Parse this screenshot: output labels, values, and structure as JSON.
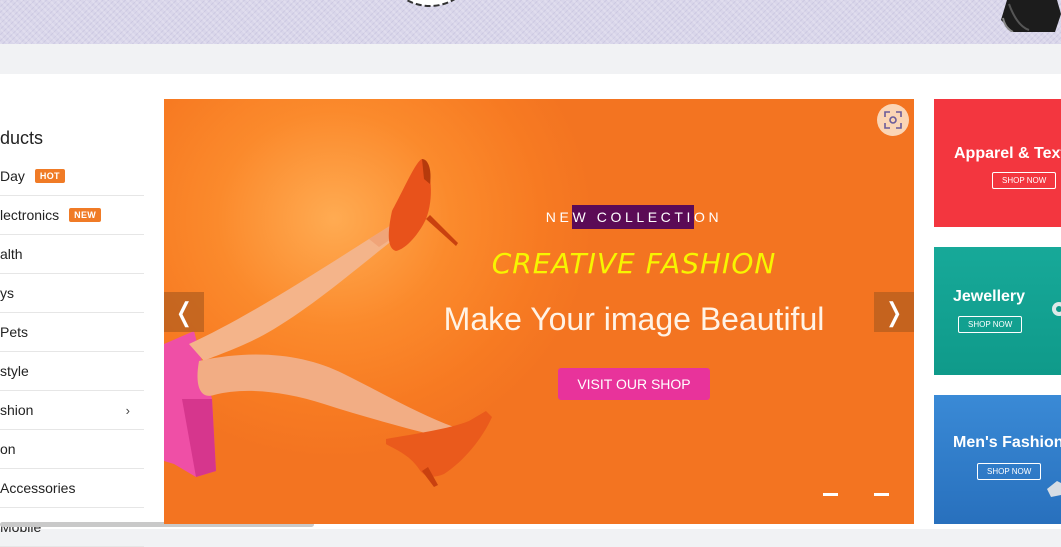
{
  "colors": {
    "hero_bg": "#f77a22",
    "visit_button": "#e8339b",
    "highlight": "#5b0b56",
    "creative_text": "#f7f500",
    "badge": "#f07b26",
    "apparel_bg": "#f3363f",
    "jewellery_bg": "#12a495",
    "mens_bg": "#2f7fcb"
  },
  "sidebar": {
    "title": "ducts",
    "items": [
      {
        "label": "Day",
        "badge": "HOT"
      },
      {
        "label": "lectronics",
        "badge": "NEW"
      },
      {
        "label": "alth"
      },
      {
        "label": "ys"
      },
      {
        "label": "Pets"
      },
      {
        "label": "style"
      },
      {
        "label": "shion",
        "chevron": "›"
      },
      {
        "label": "on"
      },
      {
        "label": "Accessories"
      },
      {
        "label": "Mobile"
      }
    ]
  },
  "hero": {
    "tagline_before": "NE",
    "tagline_highlight": "W COLLECTI",
    "tagline_after": "ON",
    "headline": "CREATIVE FASHION",
    "subheadline": "Make Your image Beautiful",
    "cta": "VISIT OUR SHOP",
    "prev_glyph": "❬",
    "next_glyph": "❭",
    "scan_icon": "scan-icon",
    "slides": 2
  },
  "promos": [
    {
      "title": "Apparel & Textile",
      "button": "SHOP NOW"
    },
    {
      "title": "Jewellery",
      "button": "SHOP NOW"
    },
    {
      "title": "Men's Fashion",
      "button": "SHOP NOW"
    }
  ]
}
